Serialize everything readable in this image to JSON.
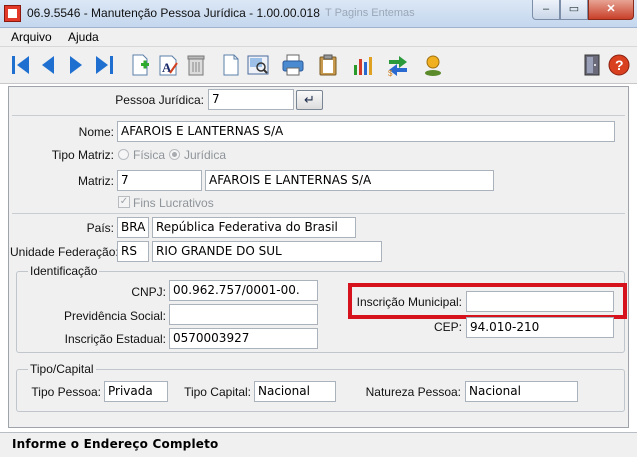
{
  "window": {
    "title": "06.9.5546 - Manutenção Pessoa Jurídica - 1.00.00.018",
    "ghost_title": "T Pagins Entemas",
    "minimize": "–",
    "maximize": "▭",
    "close": "✕"
  },
  "menu": {
    "items": [
      "Arquivo",
      "Ajuda"
    ]
  },
  "toolbar": {
    "icons": [
      "first-icon",
      "previous-icon",
      "next-icon",
      "last-icon",
      "new-document-icon",
      "edit-text-icon",
      "delete-trash-icon",
      "blank-page-icon",
      "print-preview-icon",
      "printer-icon",
      "clipboard-icon",
      "bar-chart-icon",
      "transfer-arrows-icon",
      "user-icon",
      "exit-door-icon",
      "help-icon"
    ]
  },
  "form": {
    "pessoa_juridica": {
      "label": "Pessoa Jurídica:",
      "value": "7",
      "enter": "↵"
    },
    "nome": {
      "label": "Nome:",
      "value": "AFAROIS E LANTERNAS S/A"
    },
    "tipo_matriz": {
      "label": "Tipo Matriz:",
      "options": [
        "Física",
        "Jurídica"
      ],
      "selected": "Jurídica"
    },
    "matriz": {
      "label": "Matriz:",
      "code": "7",
      "name": "AFAROIS E LANTERNAS S/A"
    },
    "fins_lucrativos": {
      "label": "Fins Lucrativos",
      "checked": true,
      "check": "✓"
    },
    "pais": {
      "label": "País:",
      "code": "BRA",
      "name": "República Federativa do Brasil"
    },
    "uf": {
      "label": "Unidade Federação:",
      "code": "RS",
      "name": "RIO GRANDE DO SUL"
    }
  },
  "identificacao": {
    "title": "Identificação",
    "cnpj": {
      "label": "CNPJ:",
      "value": "00.962.757/0001-00."
    },
    "previdencia": {
      "label": "Previdência Social:",
      "value": ""
    },
    "inscricao_estadual": {
      "label": "Inscrição Estadual:",
      "value": "0570003927"
    },
    "inscricao_municipal": {
      "label": "Inscrição Municipal:",
      "value": ""
    },
    "cep": {
      "label": "CEP:",
      "value": "94.010-210"
    }
  },
  "tipo_capital": {
    "title": "Tipo/Capital",
    "tipo_pessoa": {
      "label": "Tipo Pessoa:",
      "value": "Privada"
    },
    "tipo_capital": {
      "label": "Tipo Capital:",
      "value": "Nacional"
    },
    "natureza_pessoa": {
      "label": "Natureza Pessoa:",
      "value": "Nacional"
    }
  },
  "status": {
    "text": "Informe o Endereço Completo"
  },
  "colors": {
    "highlight": "#d6121c",
    "nav_blue": "#1f6fd0",
    "title_bar": "#c4d7ee"
  }
}
